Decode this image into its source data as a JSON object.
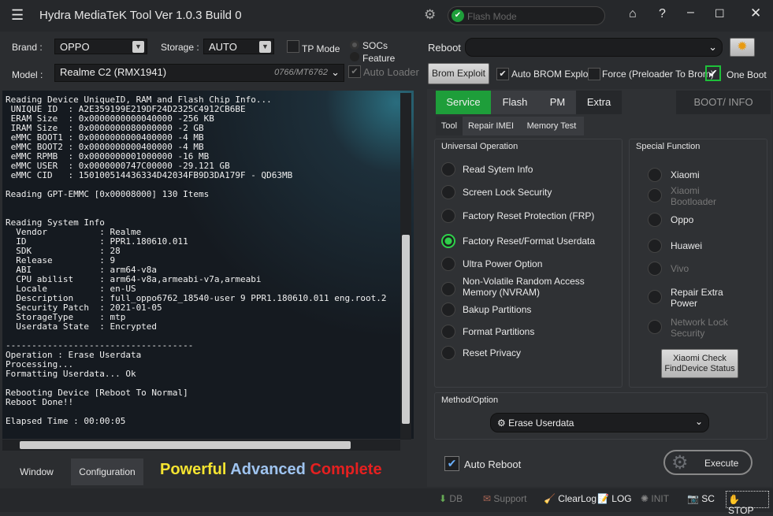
{
  "app": {
    "title": "Hydra MediaTeK Tool  Ver 1.0.3 Build 0",
    "mode": "Flash Mode"
  },
  "top": {
    "brand_label": "Brand :",
    "brand": "OPPO",
    "storage_label": "Storage :",
    "storage": "AUTO",
    "tp_mode": "TP Mode",
    "socs": "SOCs",
    "feature": "Feature",
    "model_label": "Model :",
    "model": "Realme C2 (RMX1941)",
    "chip": "0766/MT6762",
    "auto_loader": "Auto Loader",
    "reboot_label": "Reboot",
    "brom_exploit": "Brom Exploit",
    "auto_brom": "Auto BROM Exploit",
    "force": "Force (Preloader To Brom)",
    "one_boot": "One Boot"
  },
  "console": {
    "lines": "Reading Device UniqueID, RAM and Flash Chip Info...\n UNIQUE ID  : A2E359199E219DF24D2325C4912CB6BE\n ERAM Size  : 0x0000000000040000 -256 KB\n IRAM Size  : 0x0000000080000000 -2 GB\n eMMC BOOT1 : 0x0000000000400000 -4 MB\n eMMC BOOT2 : 0x0000000000400000 -4 MB\n eMMC RPMB  : 0x0000000001000000 -16 MB\n eMMC USER  : 0x0000000747C00000 -29.121 GB\n eMMC CID   : 150100514436334D42034FB9D3DA179F - QD63MB\n\nReading GPT-EMMC [0x00008000] 130 Items\n\n\nReading System Info\n  Vendor          : Realme\n  ID              : PPR1.180610.011\n  SDK             : 28\n  Release         : 9\n  ABI             : arm64-v8a\n  CPU abilist     : arm64-v8a,armeabi-v7a,armeabi\n  Locale          : en-US\n  Description     : full_oppo6762_18540-user 9 PPR1.180610.011 eng.root.2\n  Security Patch  : 2021-01-05\n  StorageType     : mtp\n  Userdata State  : Encrypted\n\n------------------------------------\nOperation : Erase Userdata\nProcessing...\nFormatting Userdata... Ok\n\nRebooting Device [Reboot To Normal]\nReboot Done!!\n\nElapsed Time : 00:00:05"
  },
  "bottom_tabs": {
    "window": "Window",
    "configuration": "Configuration"
  },
  "slogan": {
    "a": "Powerful",
    "b": "Advanced",
    "c": "Complete"
  },
  "tabs": [
    "Service",
    "Flash",
    "PM",
    "Extra"
  ],
  "boot_info": "BOOT/ INFO",
  "subtabs": [
    "Tool",
    "Repair IMEI",
    "Memory Test"
  ],
  "universal": {
    "title": "Universal Operation",
    "items": [
      "Read Sytem Info",
      "Screen Lock Security",
      "Factory Reset Protection (FRP)",
      "Factory Reset/Format Userdata",
      "Ultra Power Option",
      "Non-Volatile Random Access Memory (NVRAM)",
      "Bakup Partitions",
      "Format Partitions",
      "Reset Privacy"
    ],
    "selected": 3
  },
  "special": {
    "title": "Special Function",
    "items": [
      "Xiaomi",
      "Xiaomi Bootloader",
      "Oppo",
      "Huawei",
      "Vivo",
      "Repair Extra Power",
      "Network Lock Security"
    ],
    "xiaomi_check": "Xiaomi Check FindDevice Status"
  },
  "method": {
    "title": "Method/Option",
    "value": "Erase Userdata"
  },
  "auto_reboot": "Auto Reboot",
  "execute": "Execute",
  "status": [
    "DB",
    "Support",
    "ClearLog",
    "LOG",
    "INIT",
    "SC",
    "STOP"
  ],
  "colors": {
    "accent": "#1e9e3a",
    "stop": "#d62020"
  }
}
